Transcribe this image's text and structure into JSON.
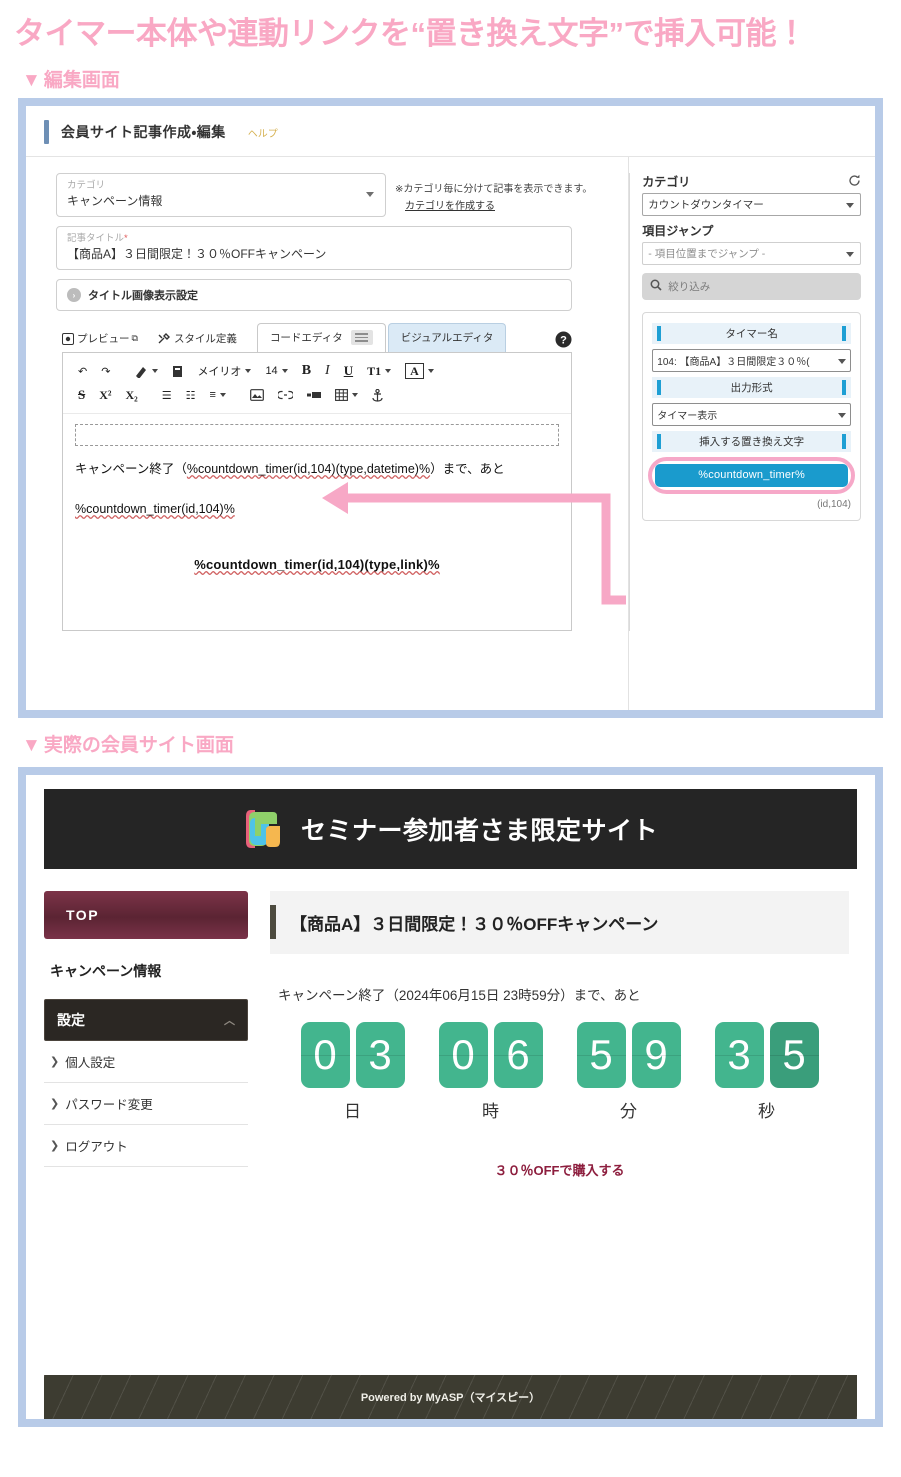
{
  "headline": "タイマー本体や連動リンクを“置き換え文字”で挿入可能！",
  "sections": {
    "editor_label": "編集画面",
    "site_label": "実際の会員サイト画面",
    "triangle": "▼"
  },
  "editor": {
    "header": {
      "title": "会員サイト記事作成・編集",
      "help": "ヘルプ"
    },
    "category": {
      "label": "カテゴリ",
      "value": "キャンペーン情報",
      "note": "※カテゴリ毎に分けて記事を表示できます。",
      "note_link": "カテゴリを作成する"
    },
    "article_title": {
      "label": "記事タイトル",
      "required_mark": "*",
      "value": "【商品A】３日間限定！３０％OFFキャンペーン"
    },
    "accordion": {
      "label": "タイトル画像表示設定",
      "chevron": "›"
    },
    "tabs": {
      "preview": "プレビュー",
      "preview_icon": "⧉",
      "style": "スタイル定義",
      "code_editor": "コードエディタ",
      "visual_editor": "ビジュアルエディタ",
      "help_icon": "question-mark-circle"
    },
    "toolbar": {
      "undo": "↶",
      "redo": "↷",
      "eraser": "🧹",
      "paste": "▤",
      "font": "メイリオ",
      "size": "14",
      "bold": "B",
      "italic": "I",
      "underline": "U",
      "text_style": "T1",
      "font_color": "A",
      "strike": "S",
      "superscript": "X²",
      "subscript": "X₂",
      "ul": "☰",
      "ol": "☷",
      "align": "≡",
      "image": "🖻",
      "link": "🔗",
      "hr": "▬",
      "table": "▦",
      "anchor": "⚓"
    },
    "content": {
      "line1_a": "キャンペーン終了（",
      "line1_token": "%countdown_timer(id,104)(type,datetime)%",
      "line1_b": "）まで、あと",
      "line2_token": "%countdown_timer(id,104)%",
      "line3_token": "%countdown_timer(id,104)(type,link)%"
    },
    "panel": {
      "category_label": "カテゴリ",
      "refresh_icon": "refresh-icon",
      "category_value": "カウントダウンタイマー",
      "jump_label": "項目ジャンプ",
      "jump_value": "- 項目位置までジャンプ -",
      "search_placeholder": "絞り込み",
      "search_icon": "search-icon",
      "timer_name_label": "タイマー名",
      "timer_name_value": "104: 【商品A】３日間限定３０％(",
      "output_label": "出力形式",
      "output_value": "タイマー表示",
      "insert_label": "挿入する置き換え文字",
      "insert_button": "%countdown_timer%",
      "insert_sub": "(id,104)"
    }
  },
  "site": {
    "header_title": "セミナー参加者さま限定サイト",
    "logo": "myasp-logo-icon",
    "sidebar": {
      "top": "TOP",
      "category": "キャンペーン情報",
      "settings_label": "設定",
      "settings_chevron": "︿",
      "items": [
        {
          "label": "個人設定"
        },
        {
          "label": "パスワード変更"
        },
        {
          "label": "ログアウト"
        }
      ]
    },
    "article": {
      "title": "【商品A】３日間限定！３０％OFFキャンペーン",
      "lead": "キャンペーン終了（2024年06月15日 23時59分）まで、あと",
      "cta": "３０％OFFで購入する"
    },
    "countdown": {
      "units": [
        {
          "label": "日",
          "digits": [
            "0",
            "3"
          ],
          "dark": [
            false,
            false
          ]
        },
        {
          "label": "時",
          "digits": [
            "0",
            "6"
          ],
          "dark": [
            false,
            false
          ]
        },
        {
          "label": "分",
          "digits": [
            "5",
            "9"
          ],
          "dark": [
            false,
            false
          ]
        },
        {
          "label": "秒",
          "digits": [
            "3",
            "5"
          ],
          "dark": [
            false,
            true
          ]
        }
      ]
    },
    "footer": "Powered by MyASP（マイスピー）"
  },
  "colors": {
    "accent_pink": "#f7a8c6",
    "frame_blue": "#b8cbe8",
    "insert_blue": "#1a9bcd",
    "timer_green": "#43b58e",
    "timer_green_dark": "#3a9e7b",
    "top_button": "#5b2433",
    "site_header": "#252525",
    "footer": "#3d3c31"
  }
}
